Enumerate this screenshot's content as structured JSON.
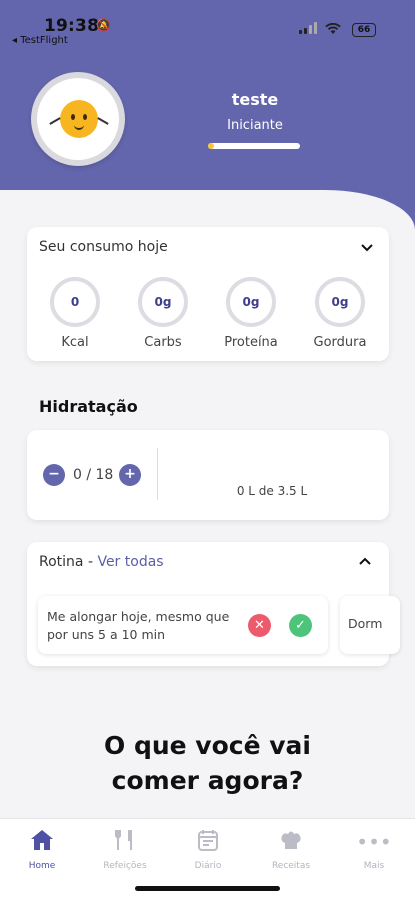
{
  "status_bar": {
    "time": "19:38",
    "back_app": "◂ TestFlight",
    "battery": "66",
    "bell_icon": "bell-slash-icon",
    "wifi_icon": "wifi-icon",
    "signal_icon": "cellular-signal-icon"
  },
  "profile": {
    "name": "teste",
    "level": "Iniciante",
    "progress_fraction": 0.06,
    "avatar_icon": "orange-mascot-icon"
  },
  "consumo": {
    "title": "Seu consumo hoje",
    "macros": [
      {
        "value": "0",
        "label": "Kcal"
      },
      {
        "value": "0g",
        "label": "Carbs"
      },
      {
        "value": "0g",
        "label": "Proteína"
      },
      {
        "value": "0g",
        "label": "Gordura"
      }
    ]
  },
  "hidratacao": {
    "title": "Hidratação",
    "count": "0 / 18",
    "liters": "0 L de 3.5 L"
  },
  "rotina": {
    "title": "Rotina",
    "separator": " - ",
    "link": "Ver todas",
    "tasks": [
      {
        "text": "Me alongar hoje, mesmo que por uns 5 a 10 min"
      },
      {
        "text": "Dorm"
      }
    ]
  },
  "question": "O que você vai comer agora?",
  "tabs": [
    {
      "label": "Home",
      "icon": "home-icon",
      "active": true
    },
    {
      "label": "Refeições",
      "icon": "cutlery-icon",
      "active": false
    },
    {
      "label": "Diário",
      "icon": "diary-icon",
      "active": false
    },
    {
      "label": "Receitas",
      "icon": "chef-hat-icon",
      "active": false
    },
    {
      "label": "Mais",
      "icon": "more-icon",
      "active": false
    }
  ],
  "colors": {
    "primary": "#6466ad",
    "progress": "#f6c33a",
    "reject": "#ec5a6b",
    "accept": "#4ec47a"
  }
}
